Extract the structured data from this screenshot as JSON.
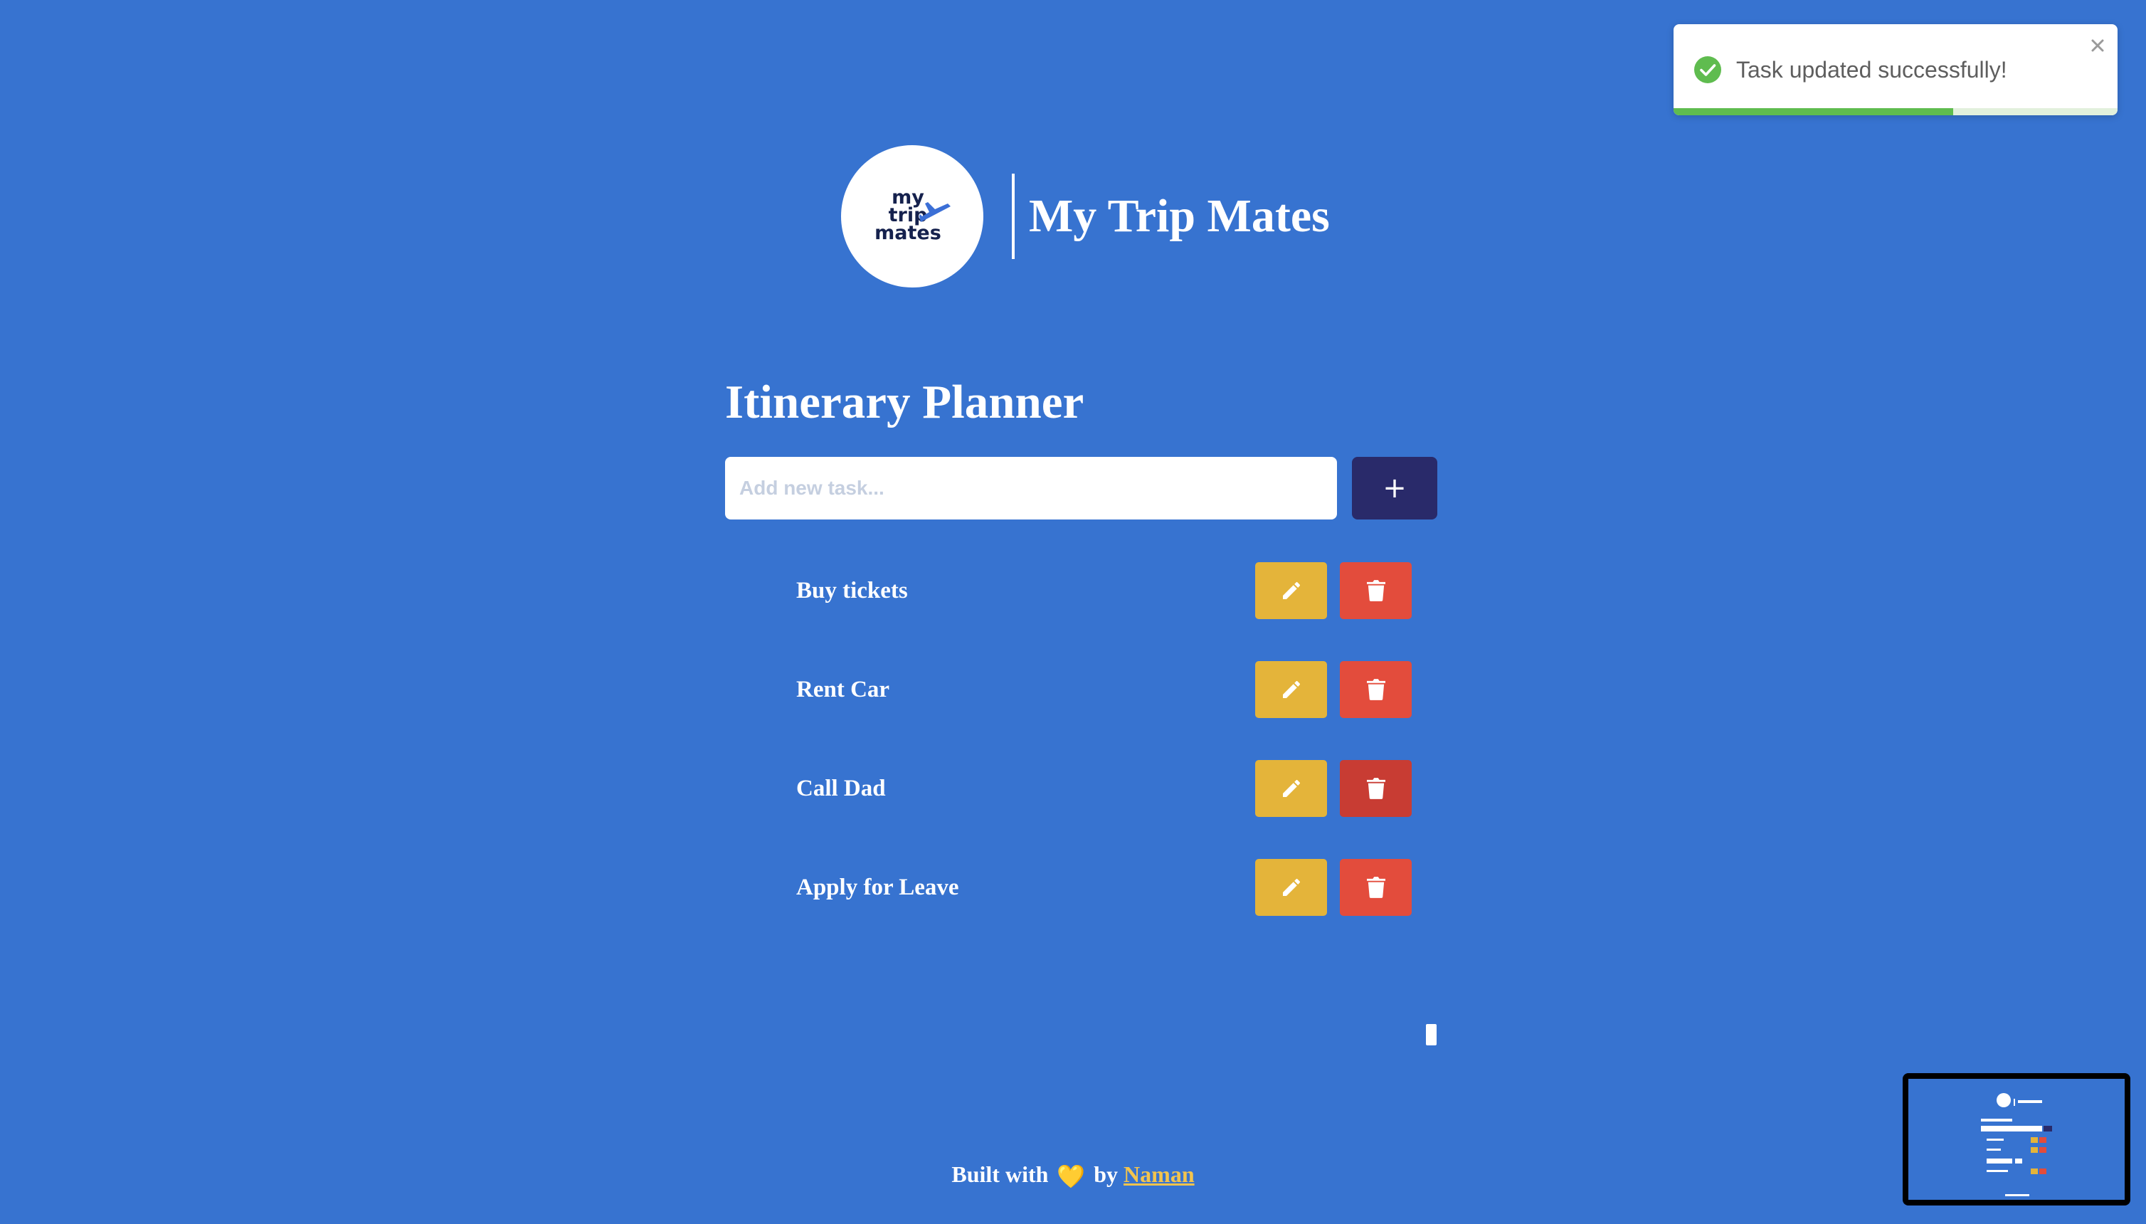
{
  "colors": {
    "background": "#3773d0",
    "add_button": "#292a6a",
    "edit_button": "#e4b43a",
    "delete_button": "#e34c3c",
    "delete_button_hover": "#c83c33",
    "toast_success": "#5fbc4f",
    "footer_link": "#f2c44e",
    "logo_text": "#15214d",
    "logo_plane": "#3b6fd6"
  },
  "header": {
    "logo_lines": [
      "my",
      "trip",
      "mates"
    ],
    "title": "My Trip Mates"
  },
  "planner": {
    "title": "Itinerary Planner",
    "input": {
      "placeholder": "Add new task...",
      "value": ""
    },
    "add_button_label": "+",
    "tasks": [
      {
        "label": "Buy tickets"
      },
      {
        "label": "Rent Car"
      },
      {
        "label": "Call Dad"
      },
      {
        "label": "Apply for Leave"
      }
    ],
    "icons": {
      "add": "plus-icon",
      "edit": "pencil-icon",
      "delete": "trash-icon"
    }
  },
  "footer": {
    "prefix": "Built with",
    "heart": "💛",
    "by": "by",
    "author": "Naman"
  },
  "toast": {
    "message": "Task updated successfully!",
    "icon": "check-circle-icon",
    "close_icon": "close-icon",
    "progress_percent": 63
  }
}
